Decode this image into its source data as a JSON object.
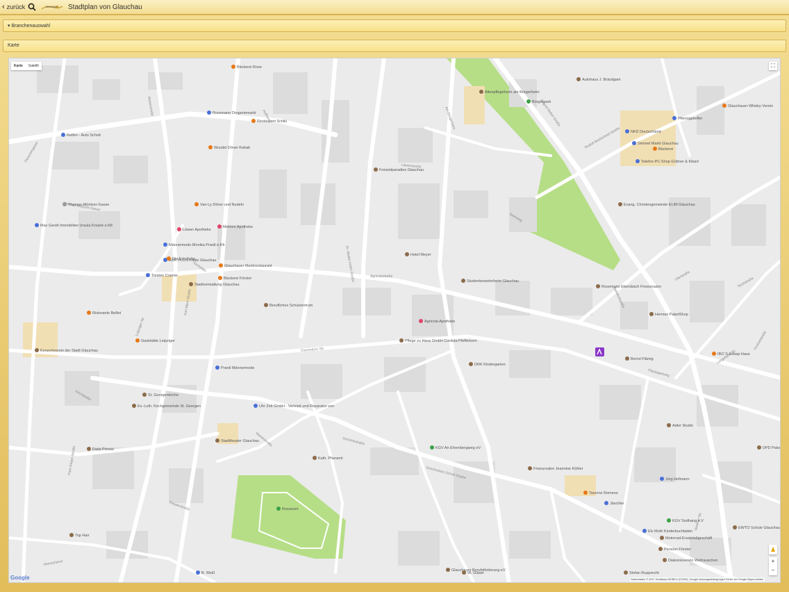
{
  "header": {
    "back_label": "zurück",
    "logo_text": "MeineStadt",
    "title": "Stadtplan von Glauchau"
  },
  "panels": {
    "branchen": "▾ Branchenauswahl",
    "karte": "Karte"
  },
  "map": {
    "type_buttons": [
      "Karte",
      "Satellit"
    ],
    "fullscreen_icon": "fullscreen-icon",
    "zoom_in": "+",
    "zoom_out": "−",
    "google_logo": "Google",
    "attribution": "Kartendaten © 2017 GeoBasis-DE/BKG (©2009), Google   Nutzungsbedingungen   Fehler bei Google Maps melden",
    "colors": {
      "road": "#ffffff",
      "background": "#ebebeb",
      "park": "#b6de87",
      "poi_orange": "#e77817",
      "poi_blue": "#4a6fd8",
      "poi_brown": "#8b6b4a",
      "poi_green": "#3aa145",
      "marker": "#8a37c7"
    },
    "streets": [
      "Fleischergasse",
      "Weberstraße",
      "Hoffnung",
      "Kirchstraße",
      "Dr.-Walter-Hofer-Straße",
      "Agricolastraße",
      "Chemnitzer Str.",
      "Gerichtsstraße",
      "Geschwister-Scholl-Straße",
      "Thomas-Müntzer-Gasse",
      "Paul-Geipel-Straße",
      "Theaterstraße",
      "Karl-Marx-Straße",
      "August-Bebel-Straße",
      "Rudolf-Breitscheid-Straße",
      "Lungwitzer Str.",
      "Leipziger Str.",
      "Plantagenweg",
      "Wettiner Str.",
      "Bahnhofstraße",
      "Uferstraße",
      "Teichstraße",
      "Am Bürgerheim",
      "Ulmenstraße",
      "Steinweg",
      "Kirchplatz",
      "Marienstraße",
      "Heinrichshof",
      "Freiheitstraße"
    ],
    "pois": [
      {
        "name": "Bäckerei Rose",
        "kind": "food"
      },
      {
        "name": "Rossmann Drogeriemarkt",
        "kind": "shop"
      },
      {
        "name": "Restaurant Schiki",
        "kind": "food"
      },
      {
        "name": "Reifen - Auto Schott",
        "kind": "shop"
      },
      {
        "name": "Wusdel Döner Kebab",
        "kind": "food"
      },
      {
        "name": "Autohaus J. Bräutigam",
        "kind": "place"
      },
      {
        "name": "Altenpflegeheim am Bürgerheim",
        "kind": "place"
      },
      {
        "name": "Bürgerpark",
        "kind": "park"
      },
      {
        "name": "Pfennigpfeiffer",
        "kind": "shop"
      },
      {
        "name": "Glauchauer Whisky-Verein",
        "kind": "food"
      },
      {
        "name": "NKD Deutschland",
        "kind": "shop"
      },
      {
        "name": "Simmel Markt Glauchau",
        "kind": "shop"
      },
      {
        "name": "Bäckerei",
        "kind": "food"
      },
      {
        "name": "Telefon-PC-Shop Güttner & Kibart",
        "kind": "shop"
      },
      {
        "name": "Freizeitparadies Glauchau",
        "kind": "place"
      },
      {
        "name": "Max Gerelt Immobilien Ursula Krüsek e.Kfr",
        "kind": "shop"
      },
      {
        "name": "Thomas-Müntzer-Gasse",
        "kind": "street"
      },
      {
        "name": "Van-Ly Döner und Nudeln",
        "kind": "food"
      },
      {
        "name": "Löwen Apotheke",
        "kind": "health"
      },
      {
        "name": "Mohren Apotheke",
        "kind": "health"
      },
      {
        "name": "Männermode Monika Prantl e.Kfr",
        "kind": "shop"
      },
      {
        "name": "AOK PLUS Filiale Glauchau",
        "kind": "shop"
      },
      {
        "name": "Die Eck-Ecke",
        "kind": "food"
      },
      {
        "name": "Glauchauer Marktrestaurant",
        "kind": "food"
      },
      {
        "name": "Torsten Cramer",
        "kind": "shop"
      },
      {
        "name": "Bäckerei Förster",
        "kind": "food"
      },
      {
        "name": "Stadtverwaltung Glauchau",
        "kind": "place"
      },
      {
        "name": "Hotel Meyer",
        "kind": "place"
      },
      {
        "name": "Evang. Christengemeinde ELIM Glauchau",
        "kind": "place"
      },
      {
        "name": "Studentenwohnheim Glauchau",
        "kind": "place"
      },
      {
        "name": "Rosemarie Ebersbach Friseursalon",
        "kind": "place"
      },
      {
        "name": "Berufliches Schulzentrum",
        "kind": "place"
      },
      {
        "name": "Ristorante Bellini",
        "kind": "food"
      },
      {
        "name": "Agricola Apotheke",
        "kind": "health"
      },
      {
        "name": "Pflege zu Haus GmbH Cordula Pfefferkorn",
        "kind": "place"
      },
      {
        "name": "Hermes PaketShop",
        "kind": "place"
      },
      {
        "name": "Gaststätte Leipziger",
        "kind": "food"
      },
      {
        "name": "Konzertverein der Stadt Glauchau",
        "kind": "place"
      },
      {
        "name": "Bernd Flämig",
        "kind": "place"
      },
      {
        "name": "IBO´S Kebap Haus",
        "kind": "food"
      },
      {
        "name": "Prantl Männermode",
        "kind": "shop"
      },
      {
        "name": "DRK Kindergarten",
        "kind": "place"
      },
      {
        "name": "St. Georgenkirche",
        "kind": "place"
      },
      {
        "name": "Ev.-Luth. Kirchgemeinde St. Georgen",
        "kind": "place"
      },
      {
        "name": "Uhr Zeit GmbH - Vertrieb und Reparatur von",
        "kind": "shop"
      },
      {
        "name": "Adler Studio",
        "kind": "place"
      },
      {
        "name": "Freie Presse",
        "kind": "place"
      },
      {
        "name": "Stadttheater Glauchau",
        "kind": "place"
      },
      {
        "name": "KGV An Ehrenbergweg eV",
        "kind": "park"
      },
      {
        "name": "Kath. Pfarramt",
        "kind": "place"
      },
      {
        "name": "DPD PaketShop",
        "kind": "place"
      },
      {
        "name": "Friseursalon Jeannine Köhler",
        "kind": "place"
      },
      {
        "name": "Jorg Hofmann",
        "kind": "shop"
      },
      {
        "name": "Taverne Romeos",
        "kind": "food"
      },
      {
        "name": "Jäschke",
        "kind": "shop"
      },
      {
        "name": "Rosarium",
        "kind": "park"
      },
      {
        "name": "KGV Sodhang e.V",
        "kind": "park"
      },
      {
        "name": "EWTO Schule Glauchau",
        "kind": "place"
      },
      {
        "name": "Elv Muth Kinderbuchladen",
        "kind": "shop"
      },
      {
        "name": "Motorrad-Ersatzteilgeschäft",
        "kind": "place"
      },
      {
        "name": "Top Hair",
        "kind": "place"
      },
      {
        "name": "Pension Förster",
        "kind": "place"
      },
      {
        "name": "Diakonieverein Weltrauschen",
        "kind": "place"
      },
      {
        "name": "Glauchauer Berufsförderung eV",
        "kind": "place"
      },
      {
        "name": "W. Gläser",
        "kind": "place"
      },
      {
        "name": "Stefan Rupprecht",
        "kind": "place"
      },
      {
        "name": "B. Weiß",
        "kind": "shop"
      }
    ]
  }
}
